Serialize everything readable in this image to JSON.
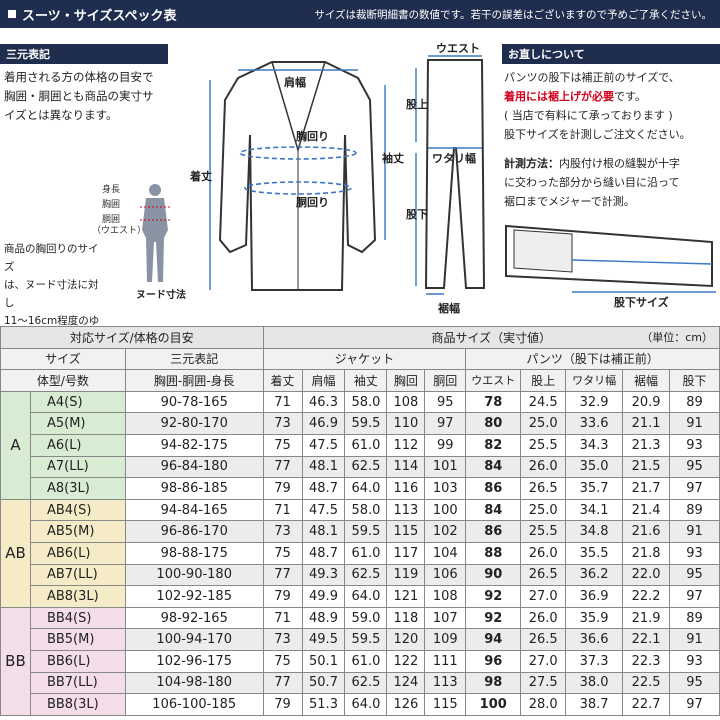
{
  "header": {
    "title": "スーツ・サイズスペック表",
    "note": "サイズは裁断明細書の数値です。若干の誤差はございますので予めご了承ください。"
  },
  "left": {
    "heading": "三元表記",
    "desc": [
      "着用される方の体格の目安で",
      "胸囲・胴囲とも商品の実寸サ",
      "イズとは異なります。"
    ],
    "body_labels": [
      "身長",
      "胸囲",
      "胴囲",
      "（ウエスト）"
    ],
    "nude_label": "ヌード寸法",
    "note": [
      "商品の胸回りのサイズ",
      "は、ヌード寸法に対し",
      "11～16cm程度のゆと",
      "りが必要です。"
    ]
  },
  "jacket_labels": {
    "shoulder": "肩幅",
    "chest": "胸回り",
    "waist": "胴回り",
    "length": "着丈",
    "sleeve": "袖丈"
  },
  "pants_labels": {
    "waist": "ウエスト",
    "rise": "股上",
    "thigh": "ワタリ幅",
    "inseam": "股下",
    "hem": "裾幅"
  },
  "right": {
    "heading": "お直しについて",
    "p1a": "パンツの股下は補正前のサイズで、",
    "p1red": "着用には裾上げが必要",
    "p1b": "です。",
    "p2": "( 当店で有料にて承っております )",
    "p3": "股下サイズを計測しご注文ください。",
    "m_label": "計測方法：",
    "m1": "内股付け根の縫製が十字",
    "m2": "に交わった部分から縫い目に沿って",
    "m3": "裾口までメジャーで計測。",
    "inseam_label": "股下サイズ"
  },
  "table": {
    "h_target": "対応サイズ/体格の目安",
    "h_product": "商品サイズ（実寸値）",
    "h_unit": "（単位：cm）",
    "h_size": "サイズ",
    "h_sangen": "三元表記",
    "h_jacket": "ジャケット",
    "h_pants": "パンツ（股下は補正前）",
    "cols": [
      "体型/号数",
      "胸囲-胴囲-身長",
      "着丈",
      "肩幅",
      "袖丈",
      "胸回",
      "胴回",
      "ウエスト",
      "股上",
      "ワタリ幅",
      "裾幅",
      "股下"
    ],
    "groups": [
      {
        "name": "A",
        "rows": [
          [
            "A4(S)",
            "90-78-165",
            "71",
            "46.3",
            "58.0",
            "108",
            "95",
            "78",
            "24.5",
            "32.9",
            "20.9",
            "89"
          ],
          [
            "A5(M)",
            "92-80-170",
            "73",
            "46.9",
            "59.5",
            "110",
            "97",
            "80",
            "25.0",
            "33.6",
            "21.1",
            "91"
          ],
          [
            "A6(L)",
            "94-82-175",
            "75",
            "47.5",
            "61.0",
            "112",
            "99",
            "82",
            "25.5",
            "34.3",
            "21.3",
            "93"
          ],
          [
            "A7(LL)",
            "96-84-180",
            "77",
            "48.1",
            "62.5",
            "114",
            "101",
            "84",
            "26.0",
            "35.0",
            "21.5",
            "95"
          ],
          [
            "A8(3L)",
            "98-86-185",
            "79",
            "48.7",
            "64.0",
            "116",
            "103",
            "86",
            "26.5",
            "35.7",
            "21.7",
            "97"
          ]
        ]
      },
      {
        "name": "AB",
        "rows": [
          [
            "AB4(S)",
            "94-84-165",
            "71",
            "47.5",
            "58.0",
            "113",
            "100",
            "84",
            "25.0",
            "34.1",
            "21.4",
            "89"
          ],
          [
            "AB5(M)",
            "96-86-170",
            "73",
            "48.1",
            "59.5",
            "115",
            "102",
            "86",
            "25.5",
            "34.8",
            "21.6",
            "91"
          ],
          [
            "AB6(L)",
            "98-88-175",
            "75",
            "48.7",
            "61.0",
            "117",
            "104",
            "88",
            "26.0",
            "35.5",
            "21.8",
            "93"
          ],
          [
            "AB7(LL)",
            "100-90-180",
            "77",
            "49.3",
            "62.5",
            "119",
            "106",
            "90",
            "26.5",
            "36.2",
            "22.0",
            "95"
          ],
          [
            "AB8(3L)",
            "102-92-185",
            "79",
            "49.9",
            "64.0",
            "121",
            "108",
            "92",
            "27.0",
            "36.9",
            "22.2",
            "97"
          ]
        ]
      },
      {
        "name": "BB",
        "rows": [
          [
            "BB4(S)",
            "98-92-165",
            "71",
            "48.9",
            "59.0",
            "118",
            "107",
            "92",
            "26.0",
            "35.9",
            "21.9",
            "89"
          ],
          [
            "BB5(M)",
            "100-94-170",
            "73",
            "49.5",
            "59.5",
            "120",
            "109",
            "94",
            "26.5",
            "36.6",
            "22.1",
            "91"
          ],
          [
            "BB6(L)",
            "102-96-175",
            "75",
            "50.1",
            "61.0",
            "122",
            "111",
            "96",
            "27.0",
            "37.3",
            "22.3",
            "93"
          ],
          [
            "BB7(LL)",
            "104-98-180",
            "77",
            "50.7",
            "62.5",
            "124",
            "113",
            "98",
            "27.5",
            "38.0",
            "22.5",
            "95"
          ],
          [
            "BB8(3L)",
            "106-100-185",
            "79",
            "51.3",
            "64.0",
            "126",
            "115",
            "100",
            "28.0",
            "38.7",
            "22.7",
            "97"
          ]
        ]
      }
    ]
  }
}
